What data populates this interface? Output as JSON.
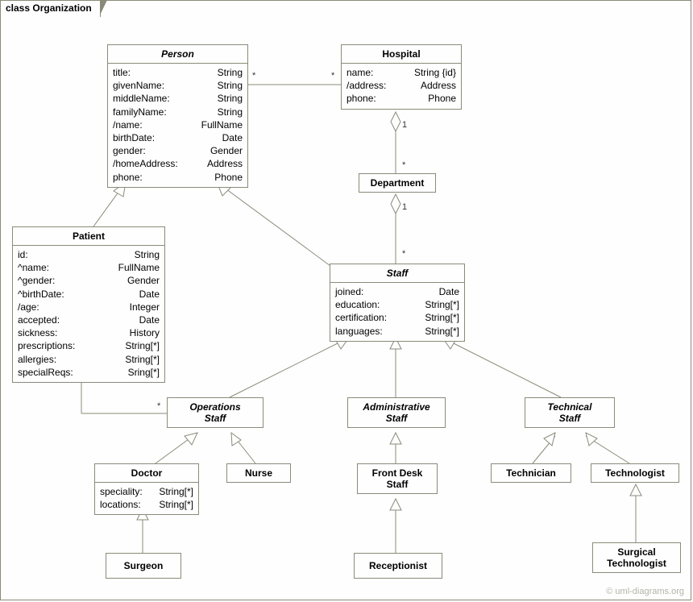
{
  "frame": {
    "title": "class Organization"
  },
  "classes": {
    "person": {
      "name": "Person",
      "attrs": [
        {
          "n": "title:",
          "t": "String"
        },
        {
          "n": "givenName:",
          "t": "String"
        },
        {
          "n": "middleName:",
          "t": "String"
        },
        {
          "n": "familyName:",
          "t": "String"
        },
        {
          "n": "/name:",
          "t": "FullName"
        },
        {
          "n": "birthDate:",
          "t": "Date"
        },
        {
          "n": "gender:",
          "t": "Gender"
        },
        {
          "n": "/homeAddress:",
          "t": "Address"
        },
        {
          "n": "phone:",
          "t": "Phone"
        }
      ]
    },
    "hospital": {
      "name": "Hospital",
      "attrs": [
        {
          "n": "name:",
          "t": "String {id}"
        },
        {
          "n": "/address:",
          "t": "Address"
        },
        {
          "n": "phone:",
          "t": "Phone"
        }
      ]
    },
    "department": {
      "name": "Department"
    },
    "patient": {
      "name": "Patient",
      "attrs": [
        {
          "n": "id:",
          "t": "String"
        },
        {
          "n": "^name:",
          "t": "FullName"
        },
        {
          "n": "^gender:",
          "t": "Gender"
        },
        {
          "n": "^birthDate:",
          "t": "Date"
        },
        {
          "n": "/age:",
          "t": "Integer"
        },
        {
          "n": "accepted:",
          "t": "Date"
        },
        {
          "n": "sickness:",
          "t": "History"
        },
        {
          "n": "prescriptions:",
          "t": "String[*]"
        },
        {
          "n": "allergies:",
          "t": "String[*]"
        },
        {
          "n": "specialReqs:",
          "t": "Sring[*]"
        }
      ]
    },
    "staff": {
      "name": "Staff",
      "attrs": [
        {
          "n": "joined:",
          "t": "Date"
        },
        {
          "n": "education:",
          "t": "String[*]"
        },
        {
          "n": "certification:",
          "t": "String[*]"
        },
        {
          "n": "languages:",
          "t": "String[*]"
        }
      ]
    },
    "opsStaff": {
      "name": "Operations",
      "name2": "Staff"
    },
    "adminStaff": {
      "name": "Administrative",
      "name2": "Staff"
    },
    "techStaff": {
      "name": "Technical",
      "name2": "Staff"
    },
    "doctor": {
      "name": "Doctor",
      "attrs": [
        {
          "n": "speciality:",
          "t": "String[*]"
        },
        {
          "n": "locations:",
          "t": "String[*]"
        }
      ]
    },
    "nurse": {
      "name": "Nurse"
    },
    "frontDesk": {
      "name": "Front Desk",
      "name2": "Staff"
    },
    "technician": {
      "name": "Technician"
    },
    "technologist": {
      "name": "Technologist"
    },
    "surgeon": {
      "name": "Surgeon"
    },
    "receptionist": {
      "name": "Receptionist"
    },
    "surgTech": {
      "name": "Surgical",
      "name2": "Technologist"
    }
  },
  "mult": {
    "person_hospital_l": "*",
    "person_hospital_r": "*",
    "hospital_dept_top": "1",
    "hospital_dept_bot": "*",
    "dept_staff_top": "1",
    "dept_staff_bot": "*",
    "patient_ops_l": "*",
    "patient_ops_r": "*"
  },
  "copyright": "© uml-diagrams.org"
}
